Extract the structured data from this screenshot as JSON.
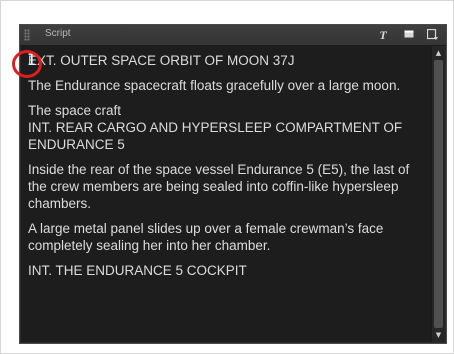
{
  "panel": {
    "title": "Script",
    "toolbar": {
      "font_button_glyph": "T",
      "font_button_icon": "text-format-icon",
      "view_button_icon": "panel-view-icon",
      "menu_button_icon": "panel-menu-icon"
    }
  },
  "script": {
    "lines": [
      "EXT. OUTER SPACE ORBIT OF MOON 37J",
      "The Endurance spacecraft floats gracefully over a large moon.",
      "The space craft\nINT. REAR CARGO AND HYPERSLEEP COMPARTMENT OF ENDURANCE 5",
      "Inside the rear of the space vessel Endurance 5 (E5), the last of the crew members are being sealed into coffin-like hypersleep chambers.",
      "A large metal panel slides up over a female crewman’s face completely sealing her into her chamber.",
      "INT. THE ENDURANCE 5 COCKPIT"
    ]
  },
  "annotation": {
    "highlight_color": "#e01e1e"
  },
  "colors": {
    "panel_bg": "#2b2b2b",
    "text_area_bg": "#1d1d1d",
    "text": "#dcdcdc"
  }
}
